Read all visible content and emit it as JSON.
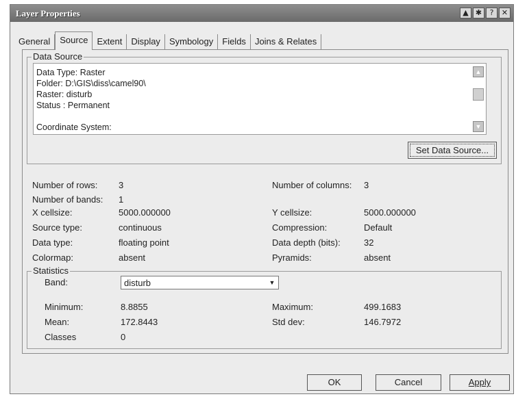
{
  "window": {
    "title": "Layer Properties",
    "controls": [
      "▲",
      "✱",
      "?",
      "✕"
    ]
  },
  "tabs": [
    "General",
    "Source",
    "Extent",
    "Display",
    "Symbology",
    "Fields",
    "Joins & Relates"
  ],
  "active_tab": "Source",
  "data_source": {
    "legend": "Data Source",
    "lines": [
      "Data Type: Raster",
      "Folder: D:\\GIS\\diss\\camel90\\",
      "Raster: disturb",
      "Status : Permanent",
      "",
      "Coordinate System:"
    ],
    "set_button": "Set Data Source..."
  },
  "properties": {
    "left": [
      {
        "label": "Number of rows:",
        "value": "3"
      },
      {
        "label": "Number of bands:",
        "value": "1"
      },
      {
        "label": "X cellsize:",
        "value": "5000.000000"
      },
      {
        "label": "Source type:",
        "value": "continuous"
      },
      {
        "label": "Data type:",
        "value": "floating point"
      },
      {
        "label": "Colormap:",
        "value": "absent"
      }
    ],
    "right": [
      {
        "label": "Number of columns:",
        "value": "3"
      },
      {
        "label": "Y cellsize:",
        "value": "5000.000000"
      },
      {
        "label": "Compression:",
        "value": "Default"
      },
      {
        "label": "Data depth (bits):",
        "value": "32"
      },
      {
        "label": "Pyramids:",
        "value": "absent"
      }
    ]
  },
  "statistics": {
    "legend": "Statistics",
    "band_label": "Band:",
    "band_value": "disturb",
    "minimum_label": "Minimum:",
    "minimum": "8.8855",
    "maximum_label": "Maximum:",
    "maximum": "499.1683",
    "mean_label": "Mean:",
    "mean": "172.8443",
    "stddev_label": "Std dev:",
    "stddev": "146.7972",
    "classes_label": "Classes",
    "classes": "0"
  },
  "footer": {
    "ok": "OK",
    "cancel": "Cancel",
    "apply": "Apply"
  }
}
